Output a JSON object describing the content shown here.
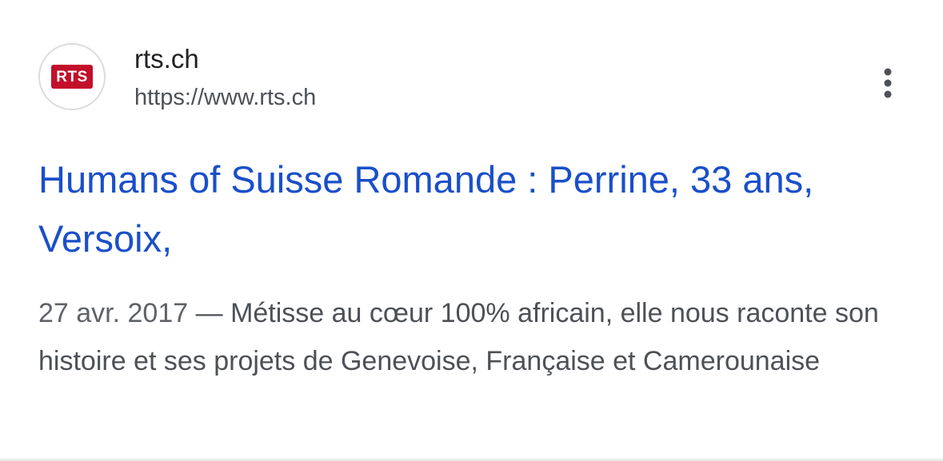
{
  "result": {
    "favicon_text": "RTS",
    "favicon_color": "#c2102b",
    "site_name": "rts.ch",
    "site_url": "https://www.rts.ch",
    "menu_icon": "more-vertical-icon",
    "title": "Humans of Suisse Romande : Perrine, 33 ans, Versoix,",
    "title_color": "#1a4fc9",
    "snippet_date": "27 avr. 2017",
    "snippet_separator": " — ",
    "snippet_text": "Métisse au cœur 100% africain, elle nous raconte son histoire et ses projets de Genevoise, Française et Camerounaise"
  }
}
